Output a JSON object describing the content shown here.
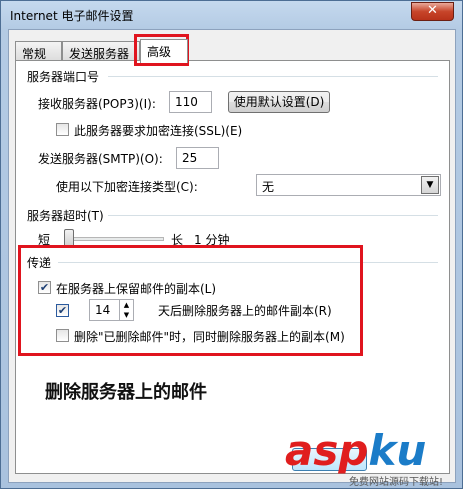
{
  "window": {
    "title": "Internet 电子邮件设置",
    "close_label": "✕"
  },
  "tabs": [
    {
      "label": "常规"
    },
    {
      "label": "发送服务器"
    },
    {
      "label": "高级"
    }
  ],
  "server_ports": {
    "group_title": "服务器端口号",
    "incoming_label": "接收服务器(POP3)(I):",
    "incoming_value": "110",
    "default_button": "使用默认设置(D)",
    "ssl_label": "此服务器要求加密连接(SSL)(E)",
    "outgoing_label": "发送服务器(SMTP)(O):",
    "outgoing_value": "25",
    "encryption_label": "使用以下加密连接类型(C):",
    "encryption_value": "无"
  },
  "timeouts": {
    "group_title": "服务器超时(T)",
    "short_label": "短",
    "long_label": "长",
    "value_text": "1 分钟",
    "slider_fraction": 0.05
  },
  "delivery": {
    "group_title": "传递",
    "leave_copy_label": "在服务器上保留邮件的副本(L)",
    "leave_copy_checked": "✔",
    "remove_after_checked": "✔",
    "remove_after_days": "14",
    "remove_after_label": "天后删除服务器上的邮件副本(R)",
    "remove_when_deleted_label": "删除\"已删除邮件\"时，同时删除服务器上的副本(M)"
  },
  "caption": "删除服务器上的邮件",
  "watermark": {
    "logo_a": "asp",
    "logo_b": "ku",
    "sub": "免费网站源码下载站!"
  },
  "colors": {
    "highlight": "#e0141e"
  }
}
